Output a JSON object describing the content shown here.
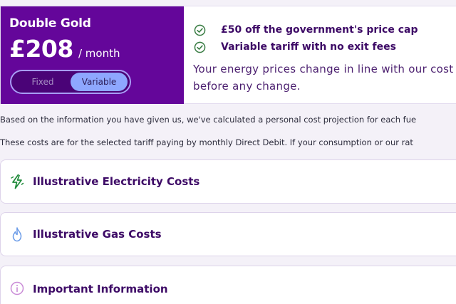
{
  "tariff": {
    "name": "Double Gold",
    "price": "£208",
    "period": "/ month",
    "toggle": {
      "fixed_label": "Fixed",
      "variable_label": "Variable",
      "selected": "Variable"
    },
    "benefits": [
      {
        "text": "£50 off the government's price cap",
        "icon": "check-circle-icon"
      },
      {
        "text": "Variable tariff with no exit fees",
        "icon": "check-circle-icon"
      }
    ],
    "description": "Your energy prices change in line with our cost before any change."
  },
  "info": {
    "line1": "Based on the information you have given us, we've calculated a personal cost projection for each fue",
    "line2": "These costs are for the selected tariff paying by monthly Direct Debit. If your consumption or our rat"
  },
  "accordions": [
    {
      "title": "Illustrative Electricity Costs",
      "icon": "lightning-icon"
    },
    {
      "title": "Illustrative Gas Costs",
      "icon": "flame-icon"
    },
    {
      "title": "Important Information",
      "icon": "info-icon"
    }
  ],
  "colors": {
    "brand_purple": "#64069a",
    "toggle_active": "#8ea7ff",
    "heading_text": "#3d0a66",
    "check_green": "#3a7d44",
    "electricity_green": "#1f8a3a",
    "gas_blue": "#6a9be8",
    "info_pink": "#c98ad6",
    "page_background": "#f4f1f8"
  }
}
